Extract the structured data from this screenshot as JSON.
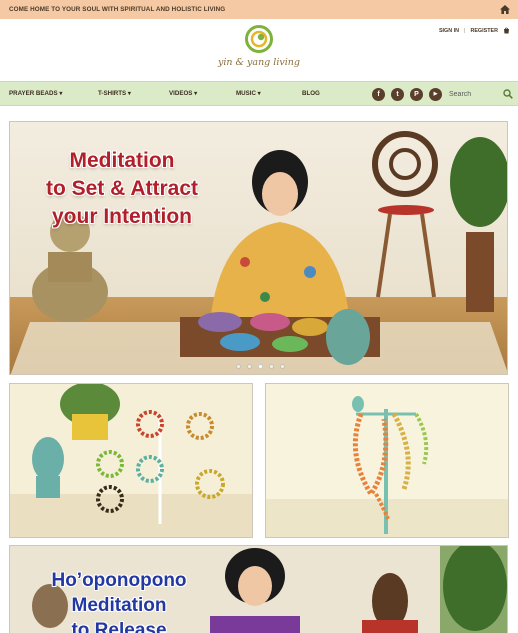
{
  "announcement": {
    "text": "COME HOME TO YOUR SOUL WITH SPIRITUAL AND HOLISTIC LIVING",
    "home_icon": "home-icon"
  },
  "header": {
    "logo_text": "yin & yang living",
    "sign_in": "SIGN IN",
    "separator": "|",
    "register": "REGISTER",
    "cart_icon": "cart-icon"
  },
  "nav": {
    "items": [
      {
        "label": "PRAYER BEADS ▾"
      },
      {
        "label": "T-SHIRTS ▾"
      },
      {
        "label": "VIDEOS ▾"
      },
      {
        "label": "MUSIC ▾"
      },
      {
        "label": "BLOG"
      }
    ],
    "social": [
      {
        "name": "facebook-icon",
        "glyph": "f"
      },
      {
        "name": "twitter-icon",
        "glyph": "t"
      },
      {
        "name": "pinterest-icon",
        "glyph": "P"
      },
      {
        "name": "youtube-icon",
        "glyph": "▶"
      }
    ],
    "search_placeholder": "Search",
    "accent": "#dbebc7"
  },
  "hero": {
    "title_line1": "Meditation",
    "title_line2": "to Set & Attract",
    "title_line3": "your Intention",
    "title_color": "#b01f2a",
    "slide_count": 5,
    "active_slide": 2
  },
  "hero2": {
    "title_line1": "Ho’oponopono",
    "title_line2": "Meditation",
    "title_line3": "to Release",
    "title_color": "#2338a0"
  }
}
